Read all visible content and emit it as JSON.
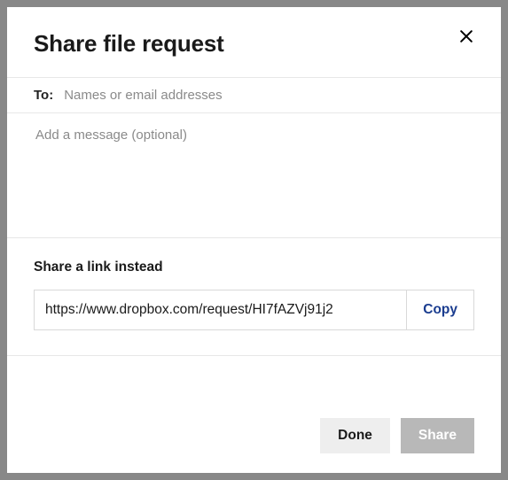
{
  "modal": {
    "title": "Share file request",
    "close_label": "Close"
  },
  "to": {
    "label": "To:",
    "placeholder": "Names or email addresses",
    "value": ""
  },
  "message": {
    "placeholder": "Add a message (optional)",
    "value": ""
  },
  "link": {
    "heading": "Share a link instead",
    "url": "https://www.dropbox.com/request/HI7fAZVj91j2",
    "copy_label": "Copy"
  },
  "footer": {
    "done_label": "Done",
    "share_label": "Share"
  },
  "colors": {
    "accent": "#1a3c8f",
    "disabled": "#b8b8b8",
    "secondary": "#eeeeee"
  }
}
